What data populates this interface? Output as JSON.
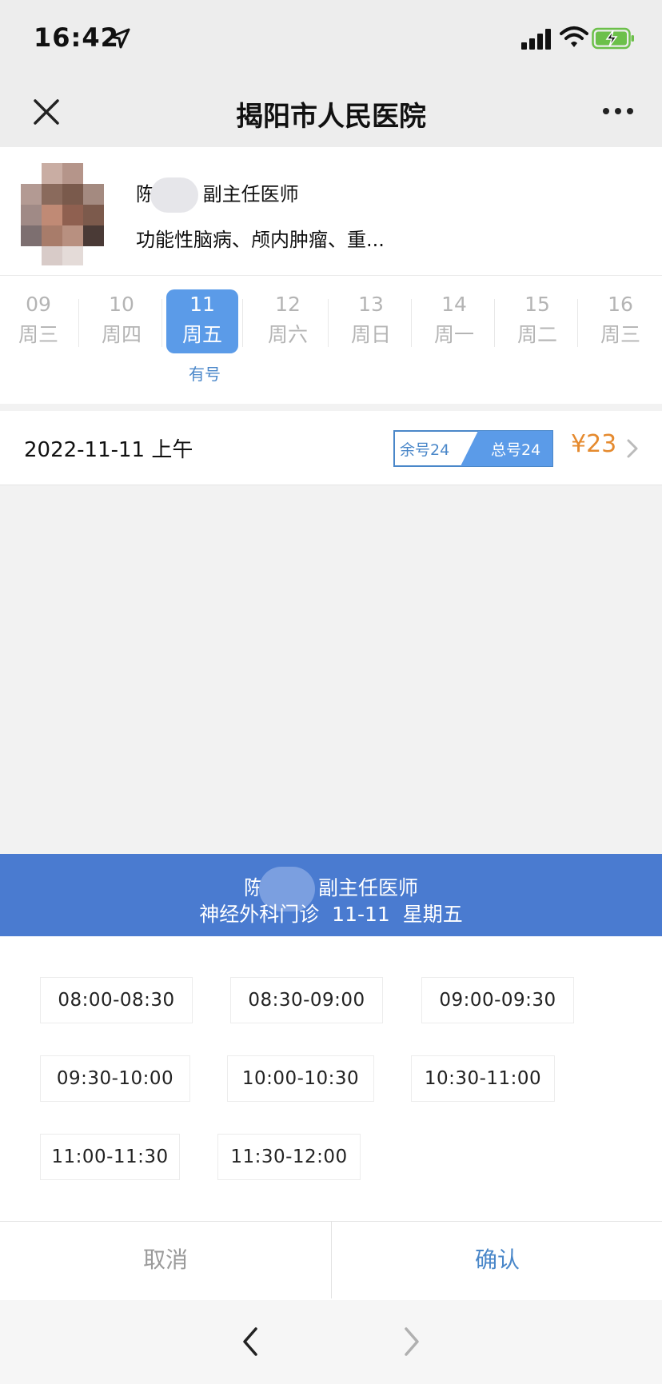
{
  "status_bar": {
    "time": "16:42"
  },
  "nav": {
    "title": "揭阳市人民医院"
  },
  "doctor": {
    "name_prefix": "陈",
    "title": "副主任医师",
    "specialty": "功能性脑病、颅内肿瘤、重..."
  },
  "dates": [
    {
      "day": "09",
      "weekday": "周三"
    },
    {
      "day": "10",
      "weekday": "周四"
    },
    {
      "day": "11",
      "weekday": "周五"
    },
    {
      "day": "12",
      "weekday": "周六"
    },
    {
      "day": "13",
      "weekday": "周日"
    },
    {
      "day": "14",
      "weekday": "周一"
    },
    {
      "day": "15",
      "weekday": "周二"
    },
    {
      "day": "16",
      "weekday": "周三"
    }
  ],
  "selected_date_status": "有号",
  "session": {
    "date_label": "2022-11-11 上午",
    "remaining": "余号24",
    "total": "总号24",
    "price": "¥23"
  },
  "sheet": {
    "doctor_prefix": "陈",
    "doctor_title": "副主任医师",
    "dept_line": "神经外科门诊  11-11  星期五",
    "time_slots": [
      "08:00-08:30",
      "08:30-09:00",
      "09:00-09:30",
      "09:30-10:00",
      "10:00-10:30",
      "10:30-11:00",
      "11:00-11:30",
      "11:30-12:00"
    ],
    "cancel_label": "取消",
    "confirm_label": "确认"
  },
  "colors": {
    "accent_blue": "#5b9be8",
    "header_blue": "#4a7bd0",
    "price_orange": "#e58a2e"
  },
  "icons": [
    "location-arrow-icon",
    "signal-icon",
    "wifi-icon",
    "battery-charging-icon",
    "close-icon",
    "more-icon",
    "chevron-right-icon",
    "back-icon",
    "forward-icon"
  ]
}
